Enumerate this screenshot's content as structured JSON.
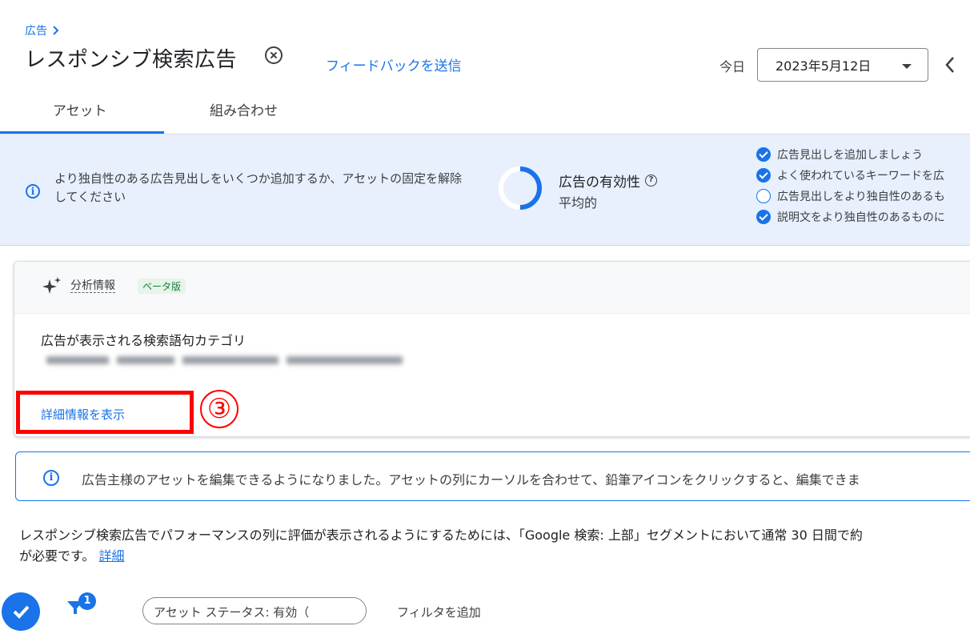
{
  "header": {
    "breadcrumb": "広告",
    "title": "レスポンシブ検索広告",
    "feedback_link": "フィードバックを送信",
    "today_label": "今日",
    "date_value": "2023年5月12日"
  },
  "tabs": [
    {
      "label": "アセット",
      "selected": true
    },
    {
      "label": "組み合わせ",
      "selected": false
    }
  ],
  "strength_banner": {
    "message": "より独自性のある広告見出しをいくつか追加するか、アセットの固定を解除してください",
    "title": "広告の有効性",
    "value": "平均的",
    "progress": 0.5,
    "checklist": [
      {
        "text": "広告見出しを追加しましょう",
        "checked": true
      },
      {
        "text": "よく使われているキーワードを広",
        "checked": true
      },
      {
        "text": "広告見出しをより独自性のあるも",
        "checked": false
      },
      {
        "text": "説明文をより独自性のあるものに",
        "checked": true
      }
    ]
  },
  "insights": {
    "label": "分析情報",
    "badge": "ベータ版",
    "category_label": "広告が表示される検索語句カテゴリ",
    "details_link": "詳細情報を表示",
    "step_marker": "③"
  },
  "notice": {
    "text": "広告主様のアセットを編集できるようになりました。アセットの列にカーソルを合わせて、鉛筆アイコンをクリックすると、編集できま"
  },
  "rating_note": {
    "line1": "レスポンシブ検索広告でパフォーマンスの列に評価が表示されるようにするためには、「Google 検索: 上部」セグメントにおいて通常 30 日間で約",
    "line2": "が必要です。",
    "link": "詳細"
  },
  "toolbar": {
    "filter_count": "1",
    "chip_text": "アセット ステータス: 有効（",
    "add_filter": "フィルタを追加"
  },
  "colors": {
    "accent": "#1a73e8",
    "banner_bg": "#e8f0fe",
    "highlight": "#ff0000"
  }
}
